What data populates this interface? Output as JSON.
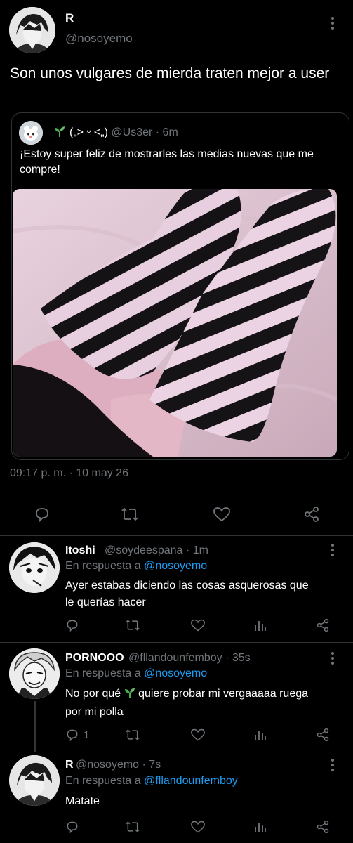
{
  "main_tweet": {
    "name": "R",
    "handle": "@nosoyemo",
    "text": "Son unos vulgares de mierda traten mejor a user",
    "timestamp": "09:17 p. m. · 10 may 26"
  },
  "quoted_tweet": {
    "name": "(„> ᵕ <„)",
    "handle": "@Us3er",
    "time": "· 6m",
    "text": "¡Estoy super feliz de mostrarles las medias nuevas que me compre!"
  },
  "replies": [
    {
      "name": "Itoshi",
      "handle": "@soydeespana",
      "time": "· 1m",
      "reply_prefix": "En respuesta a",
      "reply_to": "@nosoyemo",
      "text": "Ayer estabas diciendo las cosas asquerosas que le querías hacer",
      "reply_count": ""
    },
    {
      "name": "PORNOOO",
      "handle": "@fllandounfemboy",
      "time": "· 35s",
      "reply_prefix": "En respuesta a",
      "reply_to": "@nosoyemo",
      "text_before": "No por qué",
      "text_after": "quiere probar mi vergaaaaa ruega por mi polla",
      "reply_count": "1"
    },
    {
      "name": "R",
      "handle": "@nosoyemo",
      "time": "· 7s",
      "reply_prefix": "En respuesta a",
      "reply_to": "@fllandounfemboy",
      "text": "Matate",
      "reply_count": ""
    }
  ],
  "colors": {
    "background": "#000000",
    "text": "#e7e9ea",
    "muted": "#71767b",
    "link": "#1d9bf0",
    "divider": "#2f3336",
    "sprout": "#4caf50"
  },
  "icons": [
    "reply-icon",
    "retweet-icon",
    "like-icon",
    "share-icon",
    "views-icon",
    "more-icon",
    "sprout-icon"
  ]
}
